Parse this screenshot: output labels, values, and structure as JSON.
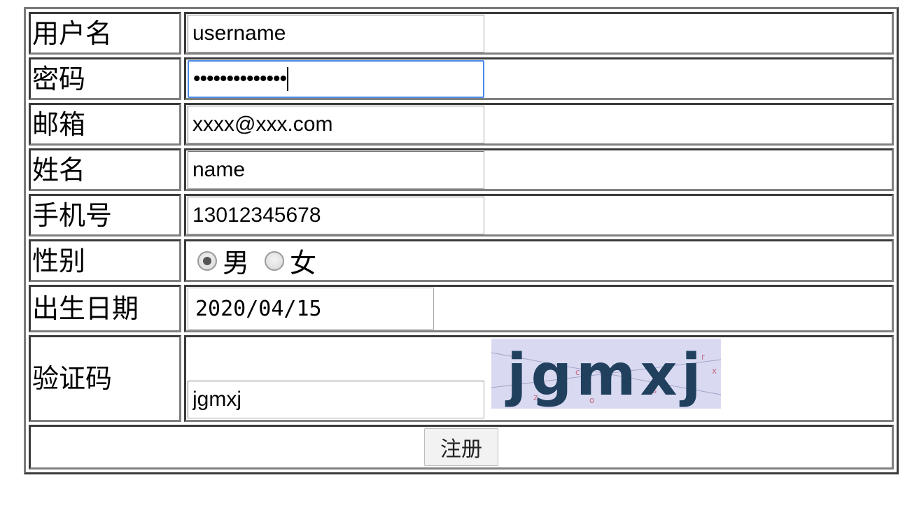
{
  "form": {
    "username": {
      "label": "用户名",
      "value": "username"
    },
    "password": {
      "label": "密码",
      "masked_value": "••••••••••••••"
    },
    "email": {
      "label": "邮箱",
      "value": "xxxx@xxx.com"
    },
    "name": {
      "label": "姓名",
      "value": "name"
    },
    "phone": {
      "label": "手机号",
      "value": "13012345678"
    },
    "gender": {
      "label": "性别",
      "options": [
        "男",
        "女"
      ],
      "selected": "男"
    },
    "birthday": {
      "label": "出生日期",
      "value": "2020/04/15"
    },
    "captcha": {
      "label": "验证码",
      "value": "jgmxj",
      "image_text": "jgmxj"
    },
    "submit_label": "注册"
  },
  "colors": {
    "focus": "#4a8ae8",
    "captcha_bg": "#d9daf2",
    "captcha_ink": "#20405e"
  }
}
